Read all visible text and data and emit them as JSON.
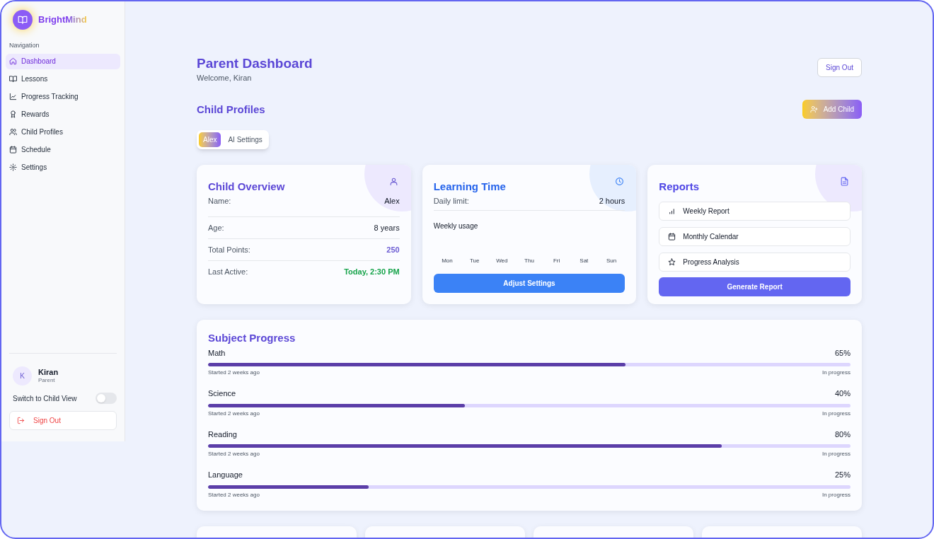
{
  "brand": {
    "name": "BrightMind"
  },
  "sidebar": {
    "heading": "Navigation",
    "items": [
      {
        "label": "Dashboard",
        "selected": true
      },
      {
        "label": "Lessons",
        "selected": false
      },
      {
        "label": "Progress Tracking",
        "selected": false
      },
      {
        "label": "Rewards",
        "selected": false
      },
      {
        "label": "Child Profiles",
        "selected": false
      },
      {
        "label": "Schedule",
        "selected": false
      },
      {
        "label": "Settings",
        "selected": false
      }
    ],
    "user": {
      "initial": "K",
      "name": "Kiran",
      "role": "Parent"
    },
    "toggle": {
      "label": "Switch to Child View",
      "on": false
    },
    "sign_out": "Sign Out"
  },
  "header": {
    "title": "Parent Dashboard",
    "welcome": "Welcome, Kiran",
    "sign_out": "Sign Out"
  },
  "profiles": {
    "title": "Child Profiles",
    "add_button": "Add Child",
    "tabs": [
      {
        "label": "Alex",
        "selected": true
      },
      {
        "label": "AI Settings",
        "selected": false
      }
    ]
  },
  "child_overview": {
    "title": "Child Overview",
    "rows": [
      {
        "label": "Name:",
        "value": "Alex",
        "kind": "plain"
      },
      {
        "label": "Age:",
        "value": "8 years",
        "kind": "plain"
      },
      {
        "label": "Total Points:",
        "value": "250",
        "kind": "accent"
      },
      {
        "label": "Last Active:",
        "value": "Today, 2:30 PM",
        "kind": "success"
      }
    ]
  },
  "learning_time": {
    "title": "Learning Time",
    "limit_label": "Daily limit:",
    "limit_value": "2 hours",
    "weekly_label": "Weekly usage",
    "days": [
      "Mon",
      "Tue",
      "Wed",
      "Thu",
      "Fri",
      "Sat",
      "Sun"
    ],
    "button": "Adjust Settings"
  },
  "reports": {
    "title": "Reports",
    "items": [
      "Weekly Report",
      "Monthly Calendar",
      "Progress Analysis"
    ],
    "button": "Generate Report"
  },
  "subject_progress": {
    "title": "Subject Progress",
    "subjects": [
      {
        "name": "Math",
        "percent": "65%",
        "level": 0.65,
        "started": "Started 2 weeks ago",
        "status": "In progress"
      },
      {
        "name": "Science",
        "percent": "40%",
        "level": 0.4,
        "started": "Started 2 weeks ago",
        "status": "In progress"
      },
      {
        "name": "Reading",
        "percent": "80%",
        "level": 0.8,
        "started": "Started 2 weeks ago",
        "status": "In progress"
      },
      {
        "name": "Language",
        "percent": "25%",
        "level": 0.25,
        "started": "Started 2 weeks ago",
        "status": "In progress"
      }
    ]
  }
}
